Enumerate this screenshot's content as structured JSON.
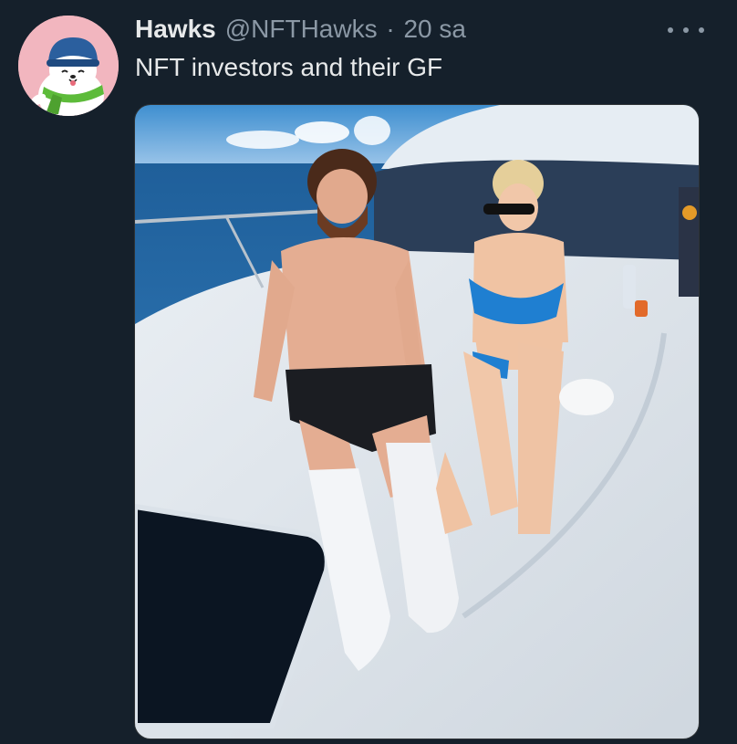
{
  "tweet": {
    "display_name": "Hawks",
    "handle": "@NFTHawks",
    "separator": "·",
    "timestamp": "20 sa",
    "text": "NFT investors and their GF",
    "more_icon": "more-horizontal-icon",
    "avatar_icon": "seal-with-scarf-avatar"
  },
  "colors": {
    "background": "#15202b",
    "primary_text": "#e7e9ea",
    "secondary_text": "#8b98a5",
    "avatar_bg": "#f2b6bf"
  }
}
